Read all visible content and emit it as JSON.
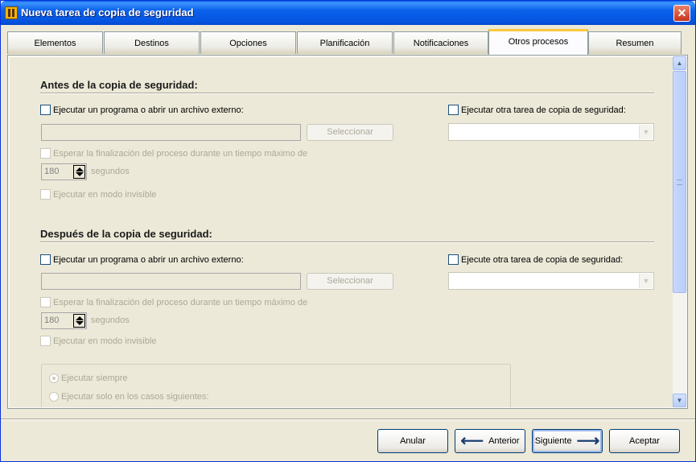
{
  "window": {
    "title": "Nueva tarea de copia de seguridad",
    "close_glyph": "✕"
  },
  "tabs": [
    {
      "label": "Elementos"
    },
    {
      "label": "Destinos"
    },
    {
      "label": "Opciones"
    },
    {
      "label": "Planificación"
    },
    {
      "label": "Notificaciones"
    },
    {
      "label": "Otros procesos",
      "active": true
    },
    {
      "label": "Resumen"
    }
  ],
  "before": {
    "title": "Antes de la copia de seguridad:",
    "run_program_label": "Ejecutar un programa o abrir un archivo externo:",
    "run_task_label": "Ejecutar otra tarea de copia de seguridad:",
    "select_button": "Seleccionar",
    "wait_label": "Esperar la finalización del proceso durante un tiempo máximo de",
    "timeout_value": "180",
    "seconds_label": "segundos",
    "invisible_label": "Ejecutar en modo invisible"
  },
  "after": {
    "title": "Después de la copia de seguridad:",
    "run_program_label": "Ejecutar un programa o abrir un archivo externo:",
    "run_task_label": "Ejecute otra tarea de copia de seguridad:",
    "select_button": "Seleccionar",
    "wait_label": "Esperar la finalización del proceso durante un tiempo máximo de",
    "timeout_value": "180",
    "seconds_label": "segundos",
    "invisible_label": "Ejecutar en modo invisible",
    "radio_always": "Ejecutar siempre",
    "radio_cases": "Ejecutar solo en los casos siguientes:"
  },
  "footer": {
    "cancel": "Anular",
    "back": "Anterior",
    "next": "Siguiente",
    "accept": "Aceptar"
  },
  "colors": {
    "titlebar": "#0553e0",
    "active_tab_accent": "#ffc83c",
    "dialog_bg": "#ece9d8",
    "disabled_text": "#aca899"
  }
}
